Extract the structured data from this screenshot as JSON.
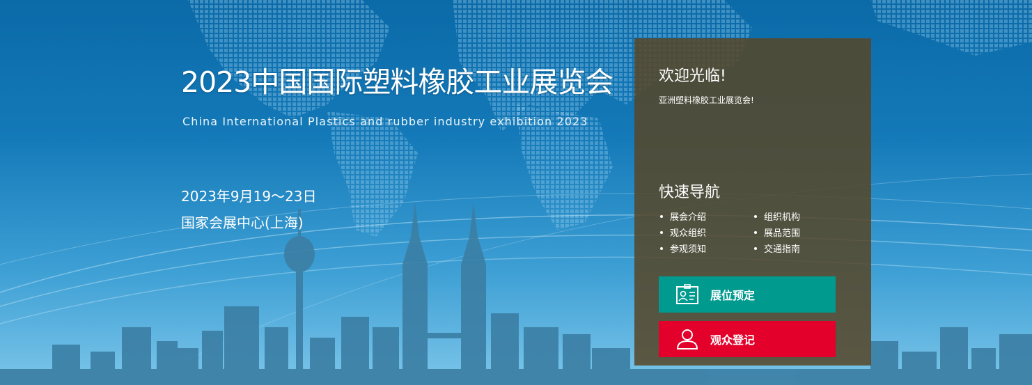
{
  "hero": {
    "title": "2023中国国际塑料橡胶工业展览会",
    "subtitle": "China International Plastics and rubber industry exhibition 2023",
    "date": "2023年9月19～23日",
    "venue": "国家会展中心(上海)"
  },
  "panel": {
    "welcome_title": "欢迎光临!",
    "welcome_text": "亚洲塑料橡胶工业展览会!",
    "nav_title": "快速导航",
    "nav_items": [
      {
        "label": "展会介绍"
      },
      {
        "label": "组织机构"
      },
      {
        "label": "观众组织"
      },
      {
        "label": "展品范围"
      },
      {
        "label": "参观须知"
      },
      {
        "label": "交通指南"
      }
    ],
    "buttons": {
      "booth": {
        "label": "展位预定",
        "icon": "id-badge-icon",
        "color": "#009a8e"
      },
      "visitor": {
        "label": "观众登记",
        "icon": "user-icon",
        "color": "#e3002b"
      }
    }
  },
  "colors": {
    "background": "#1479b8",
    "panel": "#564628"
  }
}
